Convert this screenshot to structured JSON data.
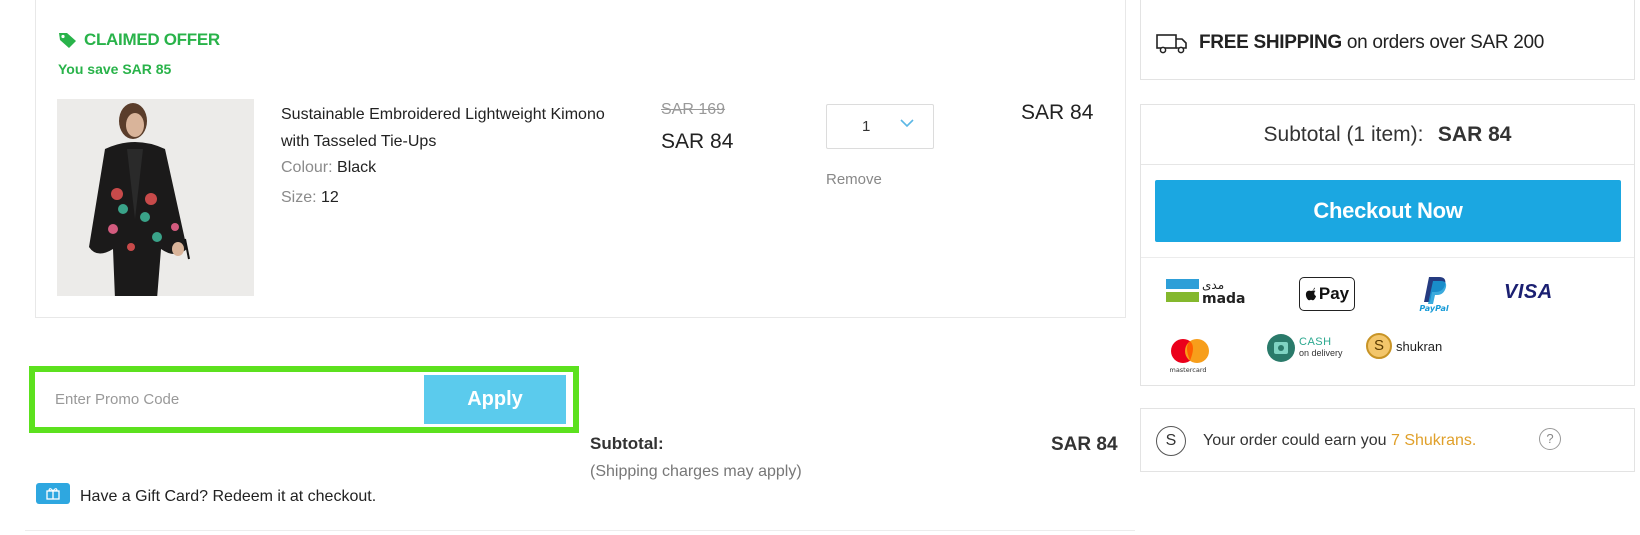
{
  "offer": {
    "title": "CLAIMED OFFER",
    "savings": "You save  SAR 85"
  },
  "product": {
    "name": "Sustainable Embroidered Lightweight Kimono with Tasseled Tie-Ups",
    "colour_label": "Colour:",
    "colour_value": "Black",
    "size_label": "Size:",
    "size_value": "12",
    "price_original": "SAR 169",
    "price_current": "SAR 84",
    "quantity": "1",
    "remove_label": "Remove",
    "line_total": "SAR 84"
  },
  "promo": {
    "placeholder": "Enter Promo Code",
    "apply_label": "Apply"
  },
  "gift_card": {
    "text": "Have a Gift Card? Redeem it at checkout."
  },
  "cart_subtotal": {
    "label": "Subtotal:",
    "note": "(Shipping charges may apply)",
    "value": "SAR 84"
  },
  "shipping_banner": {
    "bold": "FREE SHIPPING",
    "rest": " on orders over SAR 200"
  },
  "summary": {
    "label": "Subtotal (1 item):",
    "amount": "SAR 84",
    "checkout_label": "Checkout Now"
  },
  "payment_methods": {
    "mada_ar": "مدى",
    "mada": "mada",
    "apple_pay": "Pay",
    "paypal": "PayPal",
    "visa": "VISA",
    "mastercard": "mastercard",
    "cod_line1": "CASH",
    "cod_line2": "on delivery",
    "shukran": "shukran",
    "shukran_mark": "S"
  },
  "shukran_earn": {
    "icon_letter": "S",
    "prefix": "Your order could earn you ",
    "highlight": "7 Shukrans.",
    "help": "?"
  },
  "colors": {
    "offer_green": "#29b34a",
    "promo_border": "#5ce11e",
    "apply_bg": "#5bcbed",
    "checkout_bg": "#1ba7e1",
    "shukran_gold": "#e0a02a"
  }
}
